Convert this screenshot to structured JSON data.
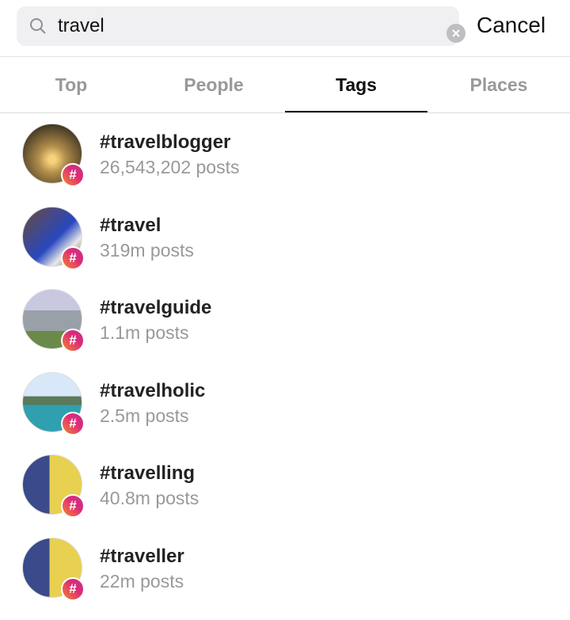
{
  "search": {
    "value": "travel",
    "icon": "search-icon",
    "clear_icon": "clear-icon",
    "cancel_label": "Cancel"
  },
  "tabs": [
    {
      "label": "Top"
    },
    {
      "label": "People"
    },
    {
      "label": "Tags",
      "active": true
    },
    {
      "label": "Places"
    }
  ],
  "results": [
    {
      "tag": "#travelblogger",
      "count": "26,543,202 posts"
    },
    {
      "tag": "#travel",
      "count": "319m posts"
    },
    {
      "tag": "#travelguide",
      "count": "1.1m posts"
    },
    {
      "tag": "#travelholic",
      "count": "2.5m posts"
    },
    {
      "tag": "#travelling",
      "count": "40.8m posts"
    },
    {
      "tag": "#traveller",
      "count": "22m posts"
    }
  ],
  "badge_symbol": "#",
  "colors": {
    "badge_start": "#f58529",
    "badge_end": "#c13584",
    "active_tab": "#111111",
    "inactive_tab": "#999999"
  }
}
